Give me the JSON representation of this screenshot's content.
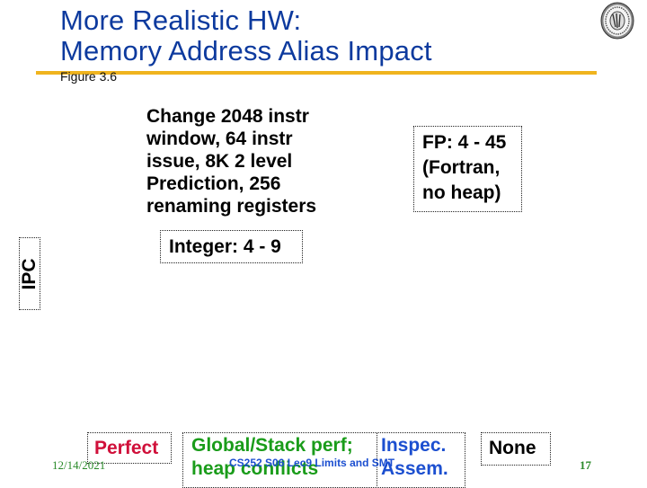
{
  "slide": {
    "title_lines": [
      "More Realistic HW:",
      "Memory Address Alias Impact"
    ],
    "subtitle": "Figure 3.6",
    "logo": "university-seal-icon"
  },
  "content": {
    "description_lines": [
      "Change  2048 instr",
      "window, 64 instr",
      "issue, 8K 2 level",
      "Prediction, 256",
      "renaming registers"
    ],
    "fp_box_lines": [
      "FP: 4 - 45",
      "(Fortran,",
      "no heap)"
    ],
    "integer_box": "Integer: 4 - 9",
    "y_axis_label": "IPC"
  },
  "categories": {
    "perfect": "Perfect",
    "global_lines": [
      "Global/Stack perf;",
      "heap conflicts"
    ],
    "inspec_lines": [
      "Inspec.",
      "Assem."
    ],
    "none": "None"
  },
  "colors": {
    "title": "#0d3a9e",
    "rule": "#f0b41e",
    "perfect": "#d0103a",
    "global": "#1a9c1a",
    "inspec": "#1c4fd0"
  },
  "footer": {
    "date": "12/14/2021",
    "course": "CS252 S06 Lec9 Limits and SMT",
    "page": "17"
  }
}
